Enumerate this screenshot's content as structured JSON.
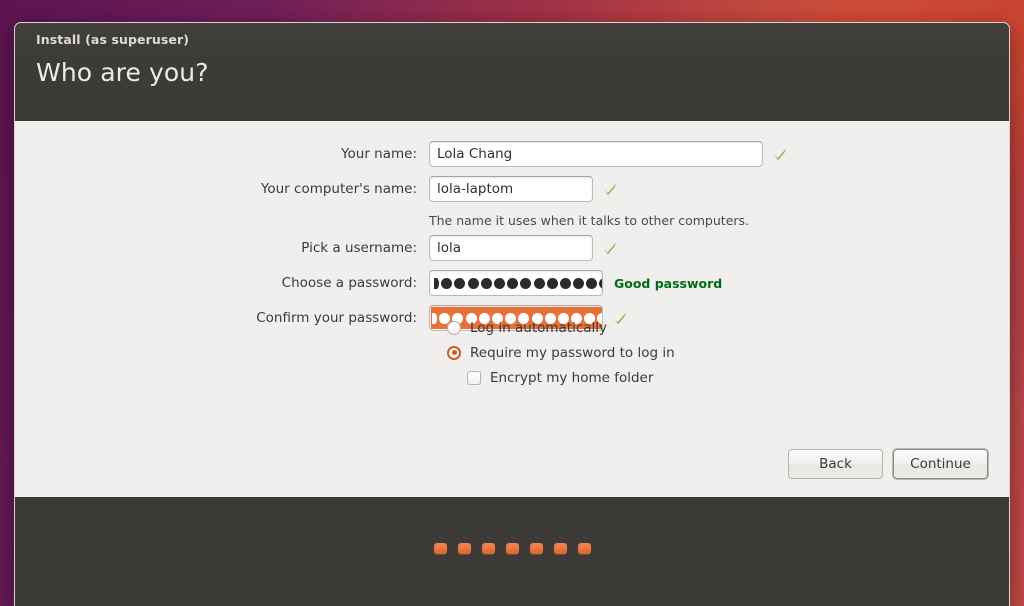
{
  "window": {
    "titlebar": "Install (as superuser)",
    "page_title": "Who are you?"
  },
  "form": {
    "fields": [
      {
        "label": "Your name:",
        "value": "Lola Chang",
        "valid_icon": "check-icon"
      },
      {
        "label": "Your computer's name:",
        "value": "lola-laptom",
        "valid_icon": "check-icon",
        "hint": "The name it uses when it talks to other computers."
      },
      {
        "label": "Pick a username:",
        "value": "lola",
        "valid_icon": "check-icon"
      },
      {
        "label": "Choose a password:",
        "value": "●●●●●●●●●●●●●",
        "masked": true,
        "bullet_count": 13,
        "strength_text": "Good password",
        "strength_color": "#006b17"
      },
      {
        "label": "Confirm your password:",
        "value": "●●●●●●●●●●●●●",
        "masked": true,
        "bullet_count": 13,
        "selected": true,
        "selection_color": "#e8703a",
        "valid_icon": "check-icon"
      }
    ]
  },
  "options": {
    "login_auto": {
      "label": "Log in automatically",
      "selected": false
    },
    "require_password": {
      "label": "Require my password to log in",
      "selected": true
    },
    "encrypt_home": {
      "label": "Encrypt my home folder",
      "checked": false
    }
  },
  "buttons": {
    "back": "Back",
    "continue": "Continue"
  },
  "footer": {
    "dot_count": 7,
    "dot_color": "#e2622b"
  },
  "colors": {
    "chrome": "#3c3b37",
    "content": "#f0efee",
    "accent_orange": "#e2622b",
    "check_green": "#7fb547",
    "desktop_purple": "#6e1f5c"
  }
}
